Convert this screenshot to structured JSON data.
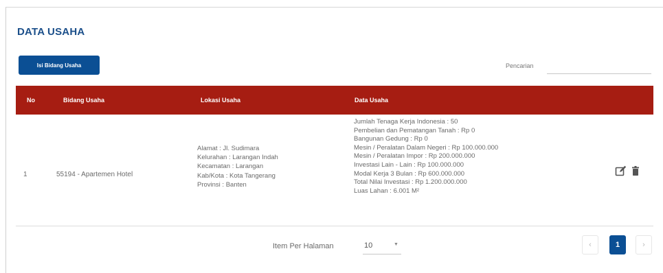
{
  "page": {
    "title": "DATA USAHA",
    "add_button": "Isi Bidang Usaha",
    "search_label": "Pencarian",
    "search_value": ""
  },
  "table": {
    "columns": [
      "No",
      "Bidang Usaha",
      "Lokasi Usaha",
      "Data Usaha"
    ],
    "rows": [
      {
        "no": "1",
        "bidang": "55194 - Apartemen Hotel",
        "lokasi": [
          "Alamat : Jl. Sudimara",
          "Kelurahan : Larangan Indah",
          "Kecamatan : Larangan",
          "Kab/Kota : Kota Tangerang",
          "Provinsi : Banten"
        ],
        "data": [
          "Jumlah Tenaga Kerja Indonesia : 50",
          "Pembelian dan Pematangan Tanah : Rp 0",
          "Bangunan Gedung : Rp 0",
          "Mesin / Peralatan Dalam Negeri : Rp 100.000.000",
          "Mesin / Peralatan Impor : Rp 200.000.000",
          "Investasi Lain - Lain : Rp 100.000.000",
          "Modal Kerja 3 Bulan : Rp 600.000.000",
          "Total Nilai Investasi : Rp 1.200.000.000",
          "Luas Lahan : 6.001 M²"
        ]
      }
    ]
  },
  "pagination": {
    "label": "Item Per Halaman",
    "per_page": "10",
    "prev": "‹",
    "current_page": "1",
    "next": "›"
  },
  "icons": {
    "edit": "edit-icon",
    "delete": "trash-icon"
  },
  "colors": {
    "header_bg": "#a61d12",
    "primary": "#0b4f94",
    "title": "#1b4f8a"
  }
}
